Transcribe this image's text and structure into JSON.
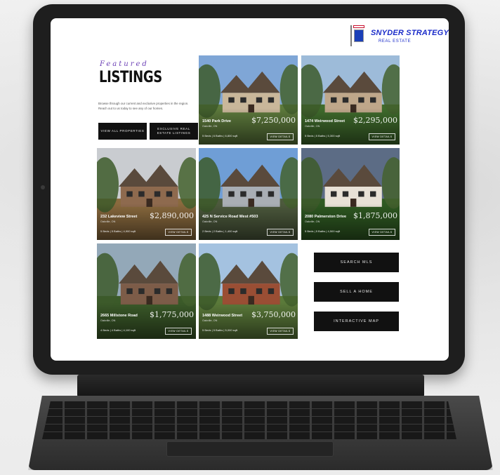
{
  "brand": {
    "name": "SNYDER STRATEGY",
    "tagline": "REAL ESTATE"
  },
  "intro": {
    "kicker": "Featured",
    "heading": "LISTINGS",
    "body": "Browse through our current and exclusive properties in the region. Reach out to us today to see any of our homes.",
    "buttons": [
      "VIEW ALL PROPERTIES",
      "EXCLUSIVE REAL ESTATE LISTINGS"
    ]
  },
  "listings": [
    {
      "address": "1540 Park Drive",
      "city": "Oakville, ON",
      "specs": "5 Beds | 6 Baths | 6,800 sqft",
      "price": "$7,250,000",
      "cta": "VIEW DETAILS",
      "photo": {
        "sky": "#7fa6d6",
        "ground": "#5d7a3c",
        "house": "#c9b79a"
      }
    },
    {
      "address": "1474 Weirwood Street",
      "city": "Oakville, ON",
      "specs": "5 Beds | 5 Baths | 5,300 sqft",
      "price": "$2,295,000",
      "cta": "VIEW DETAILS",
      "photo": {
        "sky": "#9dbbd9",
        "ground": "#3f6b2c",
        "house": "#bfa78a"
      }
    },
    {
      "address": "232 Lakeview Street",
      "city": "Oakville, ON",
      "specs": "5 Beds | 5 Baths | 4,900 sqft",
      "price": "$2,890,000",
      "cta": "VIEW DETAILS",
      "photo": {
        "sky": "#c9ccd0",
        "ground": "#8a6a3e",
        "house": "#8e6a4e"
      }
    },
    {
      "address": "425 N Service Road West #503",
      "city": "Oakville, ON",
      "specs": "2 Beds | 2 Baths | 1,400 sqft",
      "price": "",
      "cta": "VIEW DETAILS",
      "photo": {
        "sky": "#6f9ed6",
        "ground": "#4d5a3d",
        "house": "#a9aeb4"
      }
    },
    {
      "address": "2080 Palmerston Drive",
      "city": "Oakville, ON",
      "specs": "5 Beds | 5 Baths | 4,500 sqft",
      "price": "$1,875,000",
      "cta": "VIEW DETAILS",
      "photo": {
        "sky": "#5c6c85",
        "ground": "#2f5a22",
        "house": "#e8e1d6"
      }
    },
    {
      "address": "2665 Millstone Road",
      "city": "Oakville, ON",
      "specs": "4 Beds | 4 Baths | 4,100 sqft",
      "price": "$1,775,000",
      "cta": "VIEW DETAILS",
      "photo": {
        "sky": "#93a8b8",
        "ground": "#3b5a29",
        "house": "#7d5c48"
      }
    },
    {
      "address": "1488 Weirwood Street",
      "city": "Oakville, ON",
      "specs": "5 Beds | 5 Baths | 5,000 sqft",
      "price": "$3,750,000",
      "cta": "VIEW DETAILS",
      "photo": {
        "sky": "#a4c2e0",
        "ground": "#5b7a3a",
        "house": "#9a4e34"
      }
    }
  ],
  "nav_buttons": [
    "SEARCH MLS",
    "SELL A HOME",
    "INTERACTIVE MAP"
  ]
}
